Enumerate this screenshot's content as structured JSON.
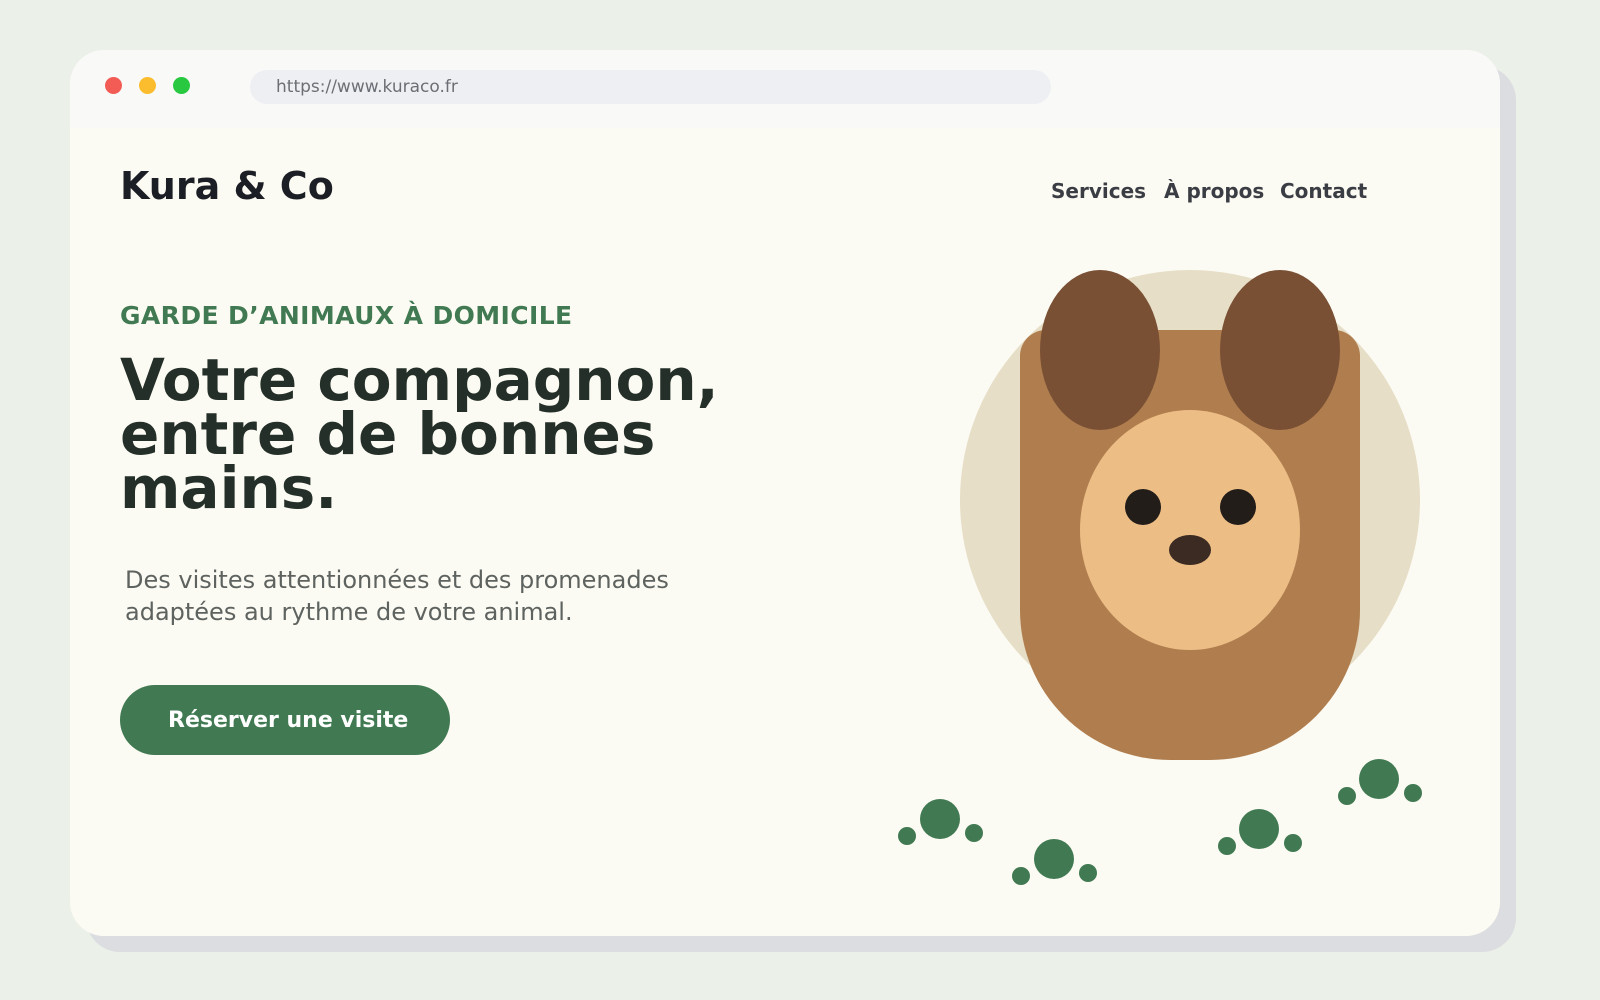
{
  "browser": {
    "url": "https://www.kuraco.fr"
  },
  "header": {
    "brand": "Kura & Co",
    "nav": [
      {
        "label": "Services"
      },
      {
        "label": "À propos"
      },
      {
        "label": "Contact"
      }
    ]
  },
  "hero": {
    "eyebrow": "GARDE D’ANIMAUX À DOMICILE",
    "headline_lines": [
      "Votre compagnon,",
      "entre de bonnes",
      "mains."
    ],
    "lede_lines": [
      "Des visites attentionnées et des promenades",
      "adaptées au rythme de votre animal."
    ],
    "cta_label": "Réserver une visite"
  },
  "illustration": {
    "icons": [
      "dog-illustration",
      "paw-print-icon"
    ]
  },
  "colors": {
    "accent": "#417a52",
    "background": "#fcfbf3",
    "dog_fur": "#b07e4e",
    "dog_ears": "#7a5035",
    "dog_face": "#ecbd85",
    "backdrop_circle": "#e6dec6"
  }
}
